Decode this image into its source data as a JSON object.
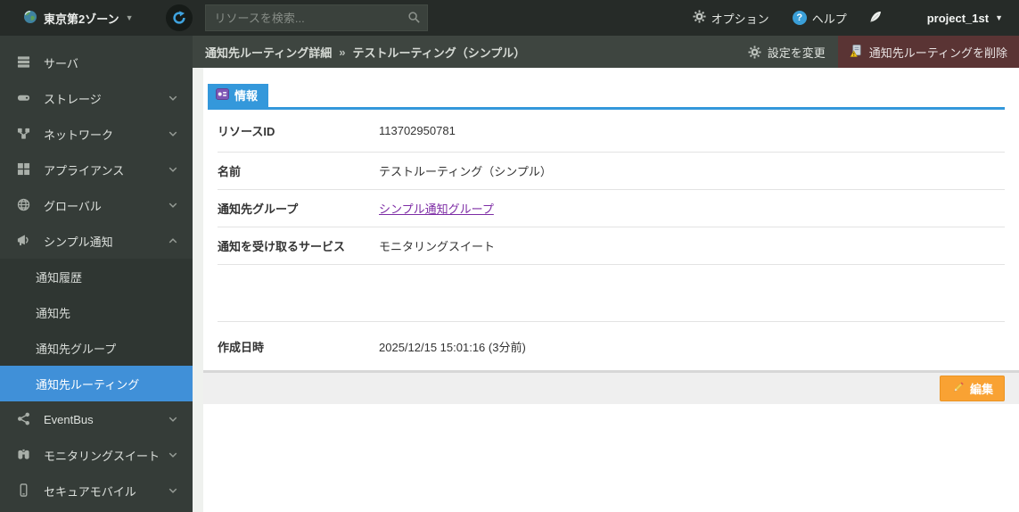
{
  "topbar": {
    "zone_label": "東京第2ゾーン",
    "zone_caret": "▼",
    "search_placeholder": "リソースを検索...",
    "options_label": "オプション",
    "help_label": "ヘルプ",
    "help_mark": "?",
    "project_label": "project_1st",
    "project_caret": "▼"
  },
  "sidebar": {
    "items_top": [
      {
        "label": "サーバ",
        "icon": "server-icon",
        "chevron": ""
      },
      {
        "label": "ストレージ",
        "icon": "storage-icon",
        "chevron": "down"
      },
      {
        "label": "ネットワーク",
        "icon": "network-icon",
        "chevron": "down"
      },
      {
        "label": "アプライアンス",
        "icon": "appliance-icon",
        "chevron": "down"
      },
      {
        "label": "グローバル",
        "icon": "globe-icon",
        "chevron": "down"
      },
      {
        "label": "シンプル通知",
        "icon": "megaphone-icon",
        "chevron": "up"
      }
    ],
    "submenu": [
      {
        "label": "通知履歴",
        "active": false
      },
      {
        "label": "通知先",
        "active": false
      },
      {
        "label": "通知先グループ",
        "active": false
      },
      {
        "label": "通知先ルーティング",
        "active": true
      }
    ],
    "items_bottom": [
      {
        "label": "EventBus",
        "icon": "share-icon",
        "chevron": "down"
      },
      {
        "label": "モニタリングスイート",
        "icon": "binoculars-icon",
        "chevron": "down"
      },
      {
        "label": "セキュアモバイル",
        "icon": "mobile-icon",
        "chevron": "down"
      }
    ]
  },
  "header": {
    "breadcrumb_main": "通知先ルーティング詳細",
    "breadcrumb_sep": "»",
    "breadcrumb_sub": "テストルーティング（シンプル）",
    "settings_label": "設定を変更",
    "delete_label": "通知先ルーティングを削除"
  },
  "main": {
    "tab_label": "情報",
    "rows": [
      {
        "label": "リソースID",
        "value": "113702950781",
        "type": "text"
      },
      {
        "label": "名前",
        "value": "テストルーティング（シンプル）",
        "type": "text"
      },
      {
        "label": "通知先グループ",
        "value": "シンプル通知グループ",
        "type": "link"
      },
      {
        "label": "通知を受け取るサービス",
        "value": "モニタリングスイート",
        "type": "text"
      },
      {
        "label": "",
        "value": "",
        "type": "spacer"
      },
      {
        "label": "作成日時",
        "value": "2025/12/15 15:01:16 (3分前)",
        "type": "text"
      }
    ],
    "edit_label": "編集"
  },
  "colors": {
    "topbar_bg": "#262b28",
    "sidebar_bg": "#353c38",
    "submenu_bg": "#2f3632",
    "active_item_blue": "#4090d8",
    "header_bg": "#3e4540",
    "delete_maroon": "#5a3434",
    "tab_blue": "#3498db",
    "link_purple": "#7d2ca5",
    "edit_orange": "#f9a233",
    "footer_gray": "#efefef"
  }
}
